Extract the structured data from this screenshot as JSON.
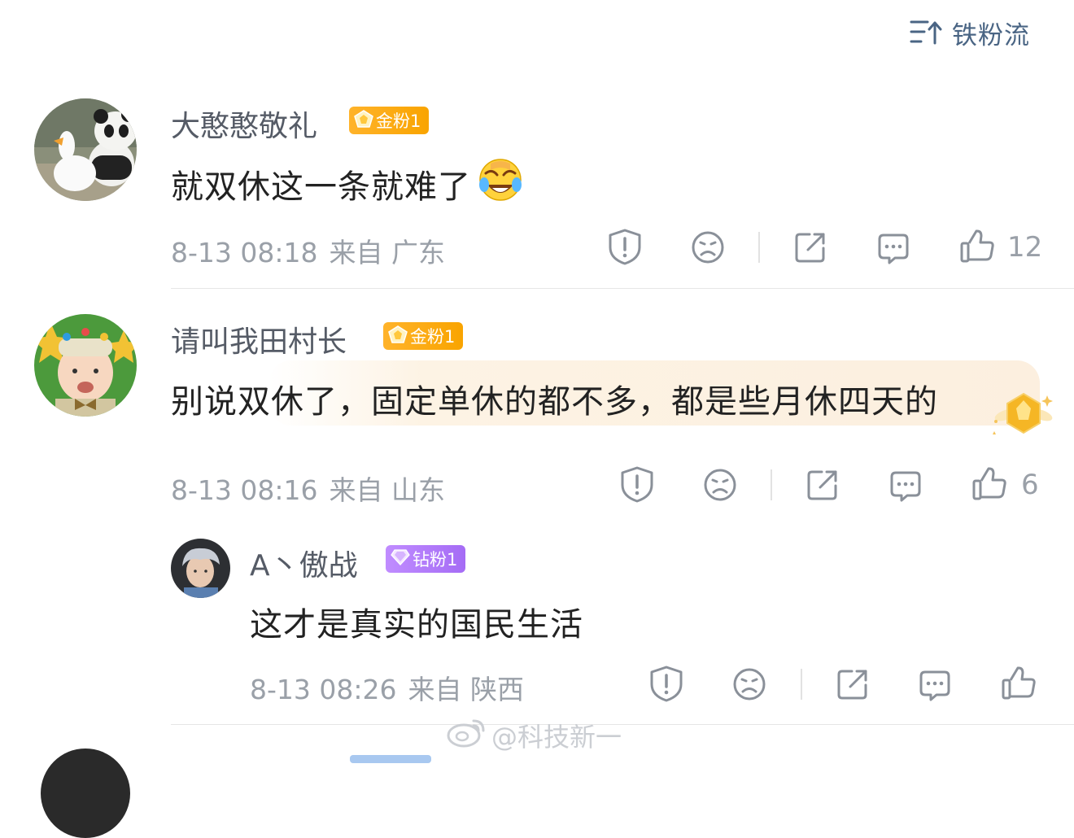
{
  "sort": {
    "label": "铁粉流",
    "icon": "sort-lines-icon"
  },
  "comments": [
    {
      "username": "大憨憨敬礼",
      "badge": "金粉1",
      "badge_type": "gold",
      "text": "就双休这一条就难了",
      "emoji": "laugh-cry-emoji",
      "date": "8-13 08:18",
      "location": "来自 广东",
      "likes": "12"
    },
    {
      "username": "请叫我田村长",
      "badge": "金粉1",
      "badge_type": "gold",
      "text": "别说双休了，固定单休的都不多，都是些月休四天的",
      "date": "8-13 08:16",
      "location": "来自 山东",
      "likes": "6"
    }
  ],
  "reply": {
    "username": "A丶傲战",
    "badge": "钻粉1",
    "badge_type": "diamond",
    "text": "这才是真实的国民生活",
    "date": "8-13 08:26",
    "location": "来自 陕西"
  },
  "watermark": "@科技新一",
  "colors": {
    "gold": "#f9a400",
    "diamond": "#a56cf5",
    "meta": "#9aa0a8",
    "link": "#4a6584"
  }
}
